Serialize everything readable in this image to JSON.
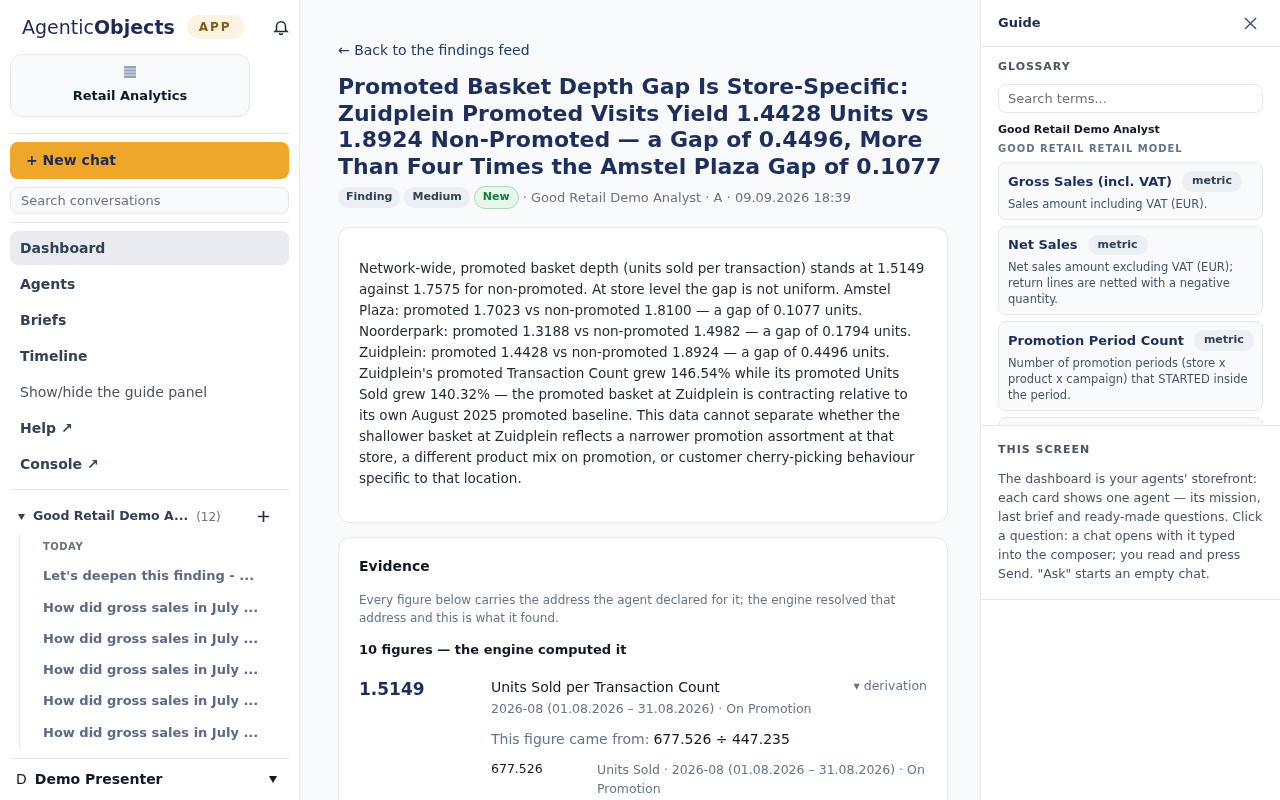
{
  "brand": {
    "name_light": "Agentic",
    "name_bold": "Objects",
    "badge": "APP"
  },
  "workspace": {
    "label": "Retail Analytics"
  },
  "new_chat": "+ New chat",
  "search": {
    "placeholder": "Search conversations"
  },
  "nav": [
    {
      "label": "Dashboard",
      "kind": "page",
      "selected": true
    },
    {
      "label": "Agents",
      "kind": "page",
      "selected": false
    },
    {
      "label": "Briefs",
      "kind": "page",
      "selected": false
    },
    {
      "label": "Timeline",
      "kind": "page",
      "selected": false
    },
    {
      "label": "Show/hide the guide panel",
      "kind": "action",
      "selected": false
    },
    {
      "label": "Help ↗",
      "kind": "page",
      "selected": false
    },
    {
      "label": "Console ↗",
      "kind": "page",
      "selected": false
    }
  ],
  "agent_group": {
    "name": "Good Retail Demo A...",
    "count": "(12)",
    "expanded": true,
    "section": "TODAY",
    "chats": [
      "Let's deepen this finding - ...",
      "How did gross sales in July ...",
      "How did gross sales in July ...",
      "How did gross sales in July ...",
      "How did gross sales in July ...",
      "How did gross sales in July ..."
    ]
  },
  "user": {
    "initial": "D",
    "name": "Demo Presenter"
  },
  "back_link": "← Back to the findings feed",
  "title": "Promoted Basket Depth Gap Is Store-Specific: Zuidplein Promoted Visits Yield 1.4428 Units vs 1.8924 Non-Promoted — a Gap of 0.4496, More Than Four Times the Amstel Plaza Gap of 0.1077",
  "tags": [
    {
      "label": "Finding",
      "kind": "neutral"
    },
    {
      "label": "Medium",
      "kind": "neutral"
    },
    {
      "label": "New",
      "kind": "new"
    }
  ],
  "meta": "· Good Retail Demo Analyst · A · 09.09.2026 18:39",
  "summary": "Network-wide, promoted basket depth (units sold per transaction) stands at 1.5149 against 1.7575 for non-promoted. At store level the gap is not uniform. Amstel Plaza: promoted 1.7023 vs non-promoted 1.8100 — a gap of 0.1077 units. Noorderpark: promoted 1.3188 vs non-promoted 1.4982 — a gap of 0.1794 units. Zuidplein: promoted 1.4428 vs non-promoted 1.8924 — a gap of 0.4496 units. Zuidplein's promoted Transaction Count grew 146.54% while its promoted Units Sold grew 140.32% — the promoted basket at Zuidplein is contracting relative to its own August 2025 promoted baseline. This data cannot separate whether the shallower basket at Zuidplein reflects a narrower promotion assortment at that store, a different product mix on promotion, or customer cherry-picking behaviour specific to that location.",
  "evidence": {
    "heading": "Evidence",
    "intro": "Every figure below carries the address the agent declared for it; the engine resolved that address and this is what it found.",
    "count_line": "10 figures — the engine computed it",
    "figures": [
      {
        "value": "1.5149",
        "name": "Units Sold per Transaction Count",
        "toggle": "▾ derivation",
        "address": "2026-08 (01.08.2026 – 31.08.2026) · On Promotion",
        "source_label": "This figure came from:",
        "source_formula": "677.526 ÷ 447.235",
        "inputs": [
          {
            "value": "677.526",
            "address": "Units Sold · 2026-08 (01.08.2026 – 31.08.2026) · On Promotion"
          }
        ]
      }
    ]
  },
  "guide": {
    "title": "Guide",
    "glossary_heading": "GLOSSARY",
    "search_placeholder": "Search terms...",
    "agent": "Good Retail Demo Analyst",
    "model": "GOOD RETAIL RETAIL MODEL",
    "terms": [
      {
        "name": "Gross Sales (incl. VAT)",
        "tag": "metric",
        "description": "Sales amount including VAT (EUR)."
      },
      {
        "name": "Net Sales",
        "tag": "metric",
        "description": "Net sales amount excluding VAT (EUR); return lines are netted with a negative quantity."
      },
      {
        "name": "Promotion Period Count",
        "tag": "metric",
        "description": "Number of promotion periods (store x product x campaign) that STARTED inside the period."
      }
    ],
    "screen_heading": "THIS SCREEN",
    "screen_text": "The dashboard is your agents' storefront: each card shows one agent — its mission, last brief and ready-made questions. Click a question: a chat opens with it typed into the composer; you read and press Send. \"Ask\" starts an empty chat."
  }
}
